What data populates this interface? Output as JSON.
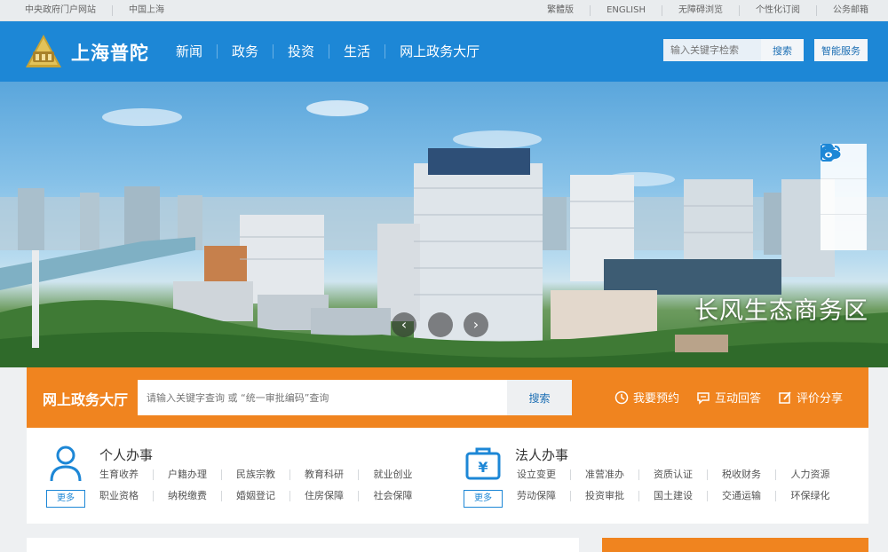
{
  "topbar": {
    "left": [
      "中央政府门户网站",
      "中国上海"
    ],
    "right": [
      "繁體版",
      "ENGLISH",
      "无障碍浏览",
      "个性化订阅",
      "公务邮箱"
    ]
  },
  "header": {
    "site_name": "上海普陀",
    "nav": [
      "新闻",
      "政务",
      "投资",
      "生活",
      "网上政务大厅"
    ],
    "search_placeholder": "输入关键字检索",
    "search_button": "搜索",
    "smart_service": "智能服务"
  },
  "banner": {
    "caption": "长风生态商务区",
    "prev_arrow": "‹",
    "next_arrow": "›"
  },
  "service": {
    "title": "网上政务大厅",
    "search_placeholder": "请输入关键字查询 或 “统一审批编码”查询",
    "search_button": "搜索",
    "links": [
      "我要预约",
      "互动回答",
      "评价分享"
    ]
  },
  "personal": {
    "title": "个人办事",
    "more": "更多",
    "row1": [
      "生育收养",
      "户籍办理",
      "民族宗教",
      "教育科研",
      "就业创业"
    ],
    "row2": [
      "职业资格",
      "纳税缴费",
      "婚姻登记",
      "住房保障",
      "社会保障"
    ]
  },
  "legal": {
    "title": "法人办事",
    "more": "更多",
    "row1": [
      "设立变更",
      "准营准办",
      "资质认证",
      "税收财务",
      "人力资源"
    ],
    "row2": [
      "劳动保障",
      "投资审批",
      "国土建设",
      "交通运输",
      "环保绿化"
    ]
  },
  "colors": {
    "brand_blue": "#1d87d6",
    "service_orange": "#f0841f"
  }
}
